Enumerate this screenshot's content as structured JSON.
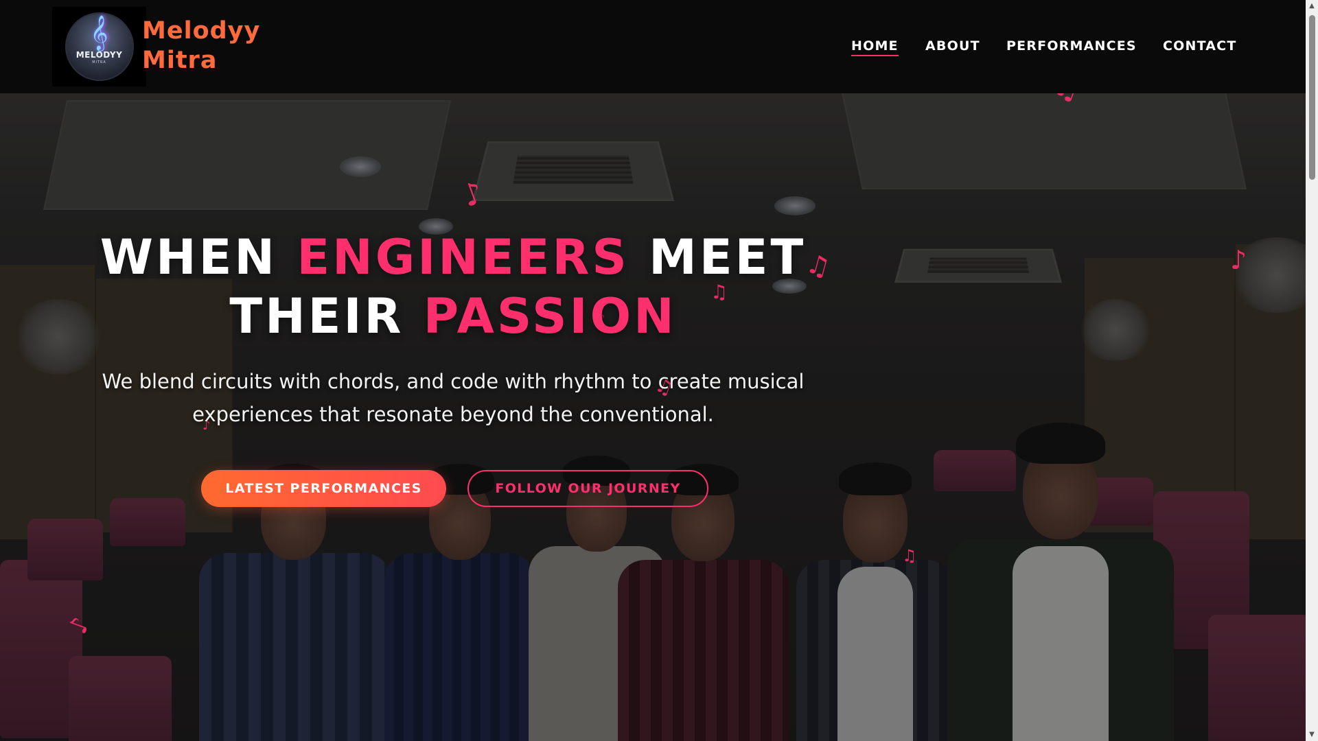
{
  "brand": {
    "logo_word": "MELODYY",
    "logo_sub": "MITRA",
    "name_line1": "Melodyy",
    "name_line2": "Mitra"
  },
  "nav": {
    "items": [
      {
        "label": "HOME",
        "active": true
      },
      {
        "label": "ABOUT",
        "active": false
      },
      {
        "label": "PERFORMANCES",
        "active": false
      },
      {
        "label": "CONTACT",
        "active": false
      }
    ]
  },
  "hero": {
    "title_part1": "WHEN ",
    "title_accent1": "ENGINEERS",
    "title_part2": " MEET",
    "title_part3": "THEIR ",
    "title_accent2": "PASSION",
    "subtitle_line1": "We blend circuits with chords, and code with rhythm to create musical",
    "subtitle_line2": "experiences that resonate beyond the conventional.",
    "primary_button": "LATEST PERFORMANCES",
    "secondary_button": "FOLLOW OUR JOURNEY"
  },
  "colors": {
    "accent_pink": "#ff2f6e",
    "accent_orange": "#ff6b3d",
    "navbar_bg": "#0a0a0b"
  },
  "decor": {
    "music_note_glyph": "♪",
    "beamed_note_glyph": "♫",
    "clef_glyph": "𝄞"
  }
}
